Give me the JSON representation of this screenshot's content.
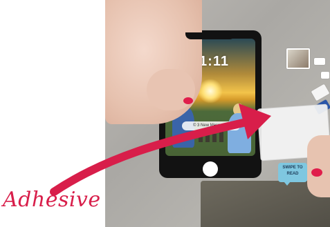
{
  "phone": {
    "lock_time": "11:11",
    "notification": "© 3 New Messages"
  },
  "sticker": {
    "swipe_text": "SWIPE TO READ"
  },
  "caption": {
    "label": "Adhesive"
  },
  "colors": {
    "accent": "#d81e4a",
    "background": "#ffffff"
  }
}
